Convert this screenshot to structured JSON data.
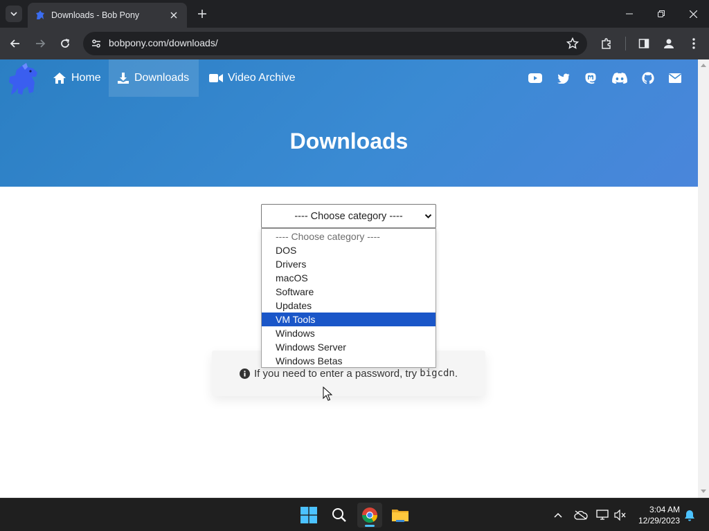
{
  "browser": {
    "tab_title": "Downloads - Bob Pony",
    "url": "bobpony.com/downloads/"
  },
  "site": {
    "nav": [
      {
        "label": "Home",
        "icon": "home-icon"
      },
      {
        "label": "Downloads",
        "icon": "download-icon",
        "active": true
      },
      {
        "label": "Video Archive",
        "icon": "video-camera-icon"
      }
    ],
    "social_icons": [
      "youtube-icon",
      "twitter-icon",
      "mastodon-icon",
      "discord-icon",
      "github-icon",
      "email-icon"
    ],
    "page_title": "Downloads",
    "hero_color": "#3a8ad3"
  },
  "category_select": {
    "value": "---- Choose category ----",
    "options": [
      "---- Choose category ----",
      "DOS",
      "Drivers",
      "macOS",
      "Software",
      "Updates",
      "VM Tools",
      "Windows",
      "Windows Server",
      "Windows Betas"
    ],
    "highlighted": "VM Tools",
    "highlight_color": "#1a56c8"
  },
  "info": {
    "text": "If you need to enter a password, try",
    "code": "bigcdn",
    "suffix": "."
  },
  "taskbar": {
    "time": "3:04 AM",
    "date": "12/29/2023"
  }
}
